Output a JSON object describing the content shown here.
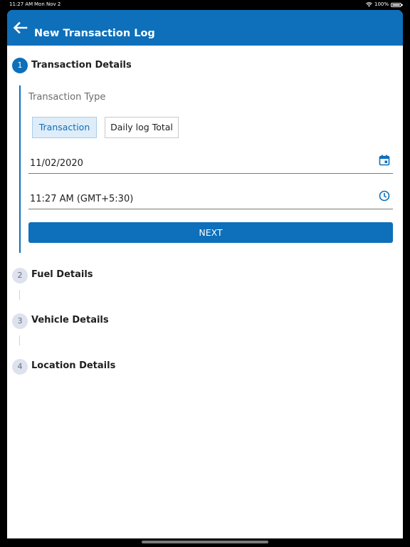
{
  "status_bar": {
    "time": "11:27 AM",
    "date": "Mon Nov 2",
    "battery": "100%",
    "wifi_icon": "wifi-icon",
    "battery_icon": "battery-icon"
  },
  "app_bar": {
    "title": "New Transaction Log",
    "back_icon": "arrow-left-icon",
    "background_color": "#0e6fba"
  },
  "steps": [
    {
      "number": "1",
      "title": "Transaction Details",
      "state": "active"
    },
    {
      "number": "2",
      "title": "Fuel Details",
      "state": "inactive"
    },
    {
      "number": "3",
      "title": "Vehicle Details",
      "state": "inactive"
    },
    {
      "number": "4",
      "title": "Location Details",
      "state": "inactive"
    }
  ],
  "transaction_details": {
    "type_label": "Transaction Type",
    "type_options": [
      {
        "label": "Transaction",
        "selected": true
      },
      {
        "label": "Daily log Total",
        "selected": false
      }
    ],
    "date_value": "11/02/2020",
    "date_icon": "calendar-icon",
    "time_value": "11:27 AM (GMT+5:30)",
    "time_icon": "clock-icon",
    "next_label": "NEXT"
  },
  "colors": {
    "accent": "#0e6fba",
    "chip_selected_bg": "#deedf9",
    "step_inactive_bg": "#dde2ee"
  }
}
